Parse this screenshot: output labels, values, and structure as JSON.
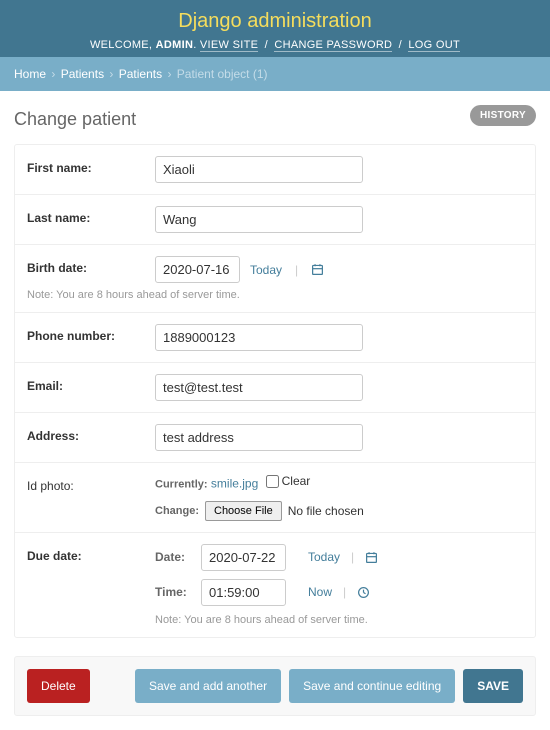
{
  "header": {
    "title": "Django administration",
    "welcome": "WELCOME,",
    "user": "ADMIN",
    "view_site": "VIEW SITE",
    "change_password": "CHANGE PASSWORD",
    "log_out": "LOG OUT"
  },
  "breadcrumbs": {
    "home": "Home",
    "app": "Patients",
    "model": "Patients",
    "object": "Patient object (1)"
  },
  "page": {
    "title": "Change patient",
    "history": "HISTORY"
  },
  "form": {
    "first_name": {
      "label": "First name:",
      "value": "Xiaoli"
    },
    "last_name": {
      "label": "Last name:",
      "value": "Wang"
    },
    "birth_date": {
      "label": "Birth date:",
      "value": "2020-07-16",
      "today": "Today",
      "tz_note": "Note: You are 8 hours ahead of server time."
    },
    "phone": {
      "label": "Phone number:",
      "value": "1889000123"
    },
    "email": {
      "label": "Email:",
      "value": "test@test.test"
    },
    "address": {
      "label": "Address:",
      "value": "test address"
    },
    "id_photo": {
      "label": "Id photo:",
      "currently_label": "Currently:",
      "currently_file": "smile.jpg",
      "clear_label": "Clear",
      "change_label": "Change:",
      "choose_btn": "Choose File",
      "no_file": "No file chosen"
    },
    "due_date": {
      "label": "Due date:",
      "date_label": "Date:",
      "date_value": "2020-07-22",
      "today": "Today",
      "time_label": "Time:",
      "time_value": "01:59:00",
      "now": "Now",
      "tz_note": "Note: You are 8 hours ahead of server time."
    }
  },
  "submit": {
    "delete": "Delete",
    "save_add": "Save and add another",
    "save_continue": "Save and continue editing",
    "save": "SAVE"
  }
}
